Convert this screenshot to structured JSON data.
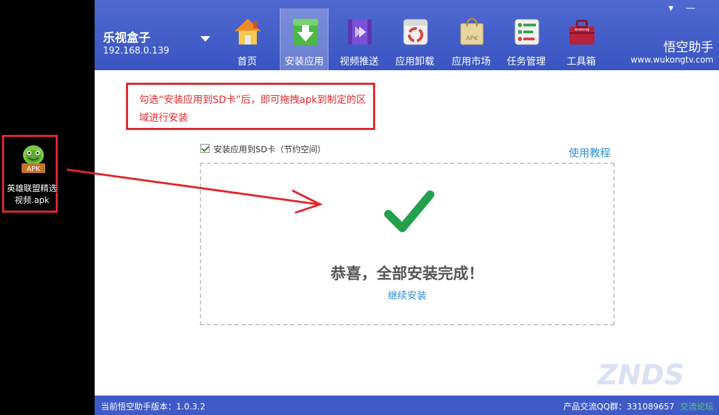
{
  "desktop": {
    "apk_file": {
      "icon": "android-apk-icon",
      "badge": "APK",
      "name": "英雄联盟精选视频.apk"
    }
  },
  "window": {
    "controls": {
      "menu": "▾",
      "minimize": "—"
    },
    "device": {
      "name": "乐视盒子",
      "ip": "192.168.0.139"
    },
    "nav": {
      "tabs": [
        {
          "label": "首页",
          "icon": "home-icon"
        },
        {
          "label": "安装应用",
          "icon": "install-download-icon",
          "active": true
        },
        {
          "label": "视频推送",
          "icon": "video-push-icon"
        },
        {
          "label": "应用卸载",
          "icon": "uninstall-icon"
        },
        {
          "label": "应用市场",
          "icon": "app-market-bag-icon",
          "icon_text": "APK"
        },
        {
          "label": "任务管理",
          "icon": "task-manager-icon"
        },
        {
          "label": "工具箱",
          "icon": "toolbox-icon",
          "icon_text": "wukong"
        }
      ]
    },
    "brand": {
      "name": "悟空助手",
      "url": "www.wukongtv.com"
    },
    "tip": {
      "text": "勾选“安装应用到SD卡”后，即可拖拽apk到制定的区域进行安装"
    },
    "sd_option": {
      "label": "安装应用到SD卡（节约空间）",
      "checked": true
    },
    "tutorial_link": "使用教程",
    "result": {
      "message": "恭喜，全部安装完成！",
      "continue_link": "继续安装"
    },
    "watermark": "ZNDS",
    "footer": {
      "version_label": "当前悟空助手版本：1.0.3.2",
      "qq_group": "产品交流QQ群：331089657",
      "forum_link": "交流论坛"
    }
  },
  "colors": {
    "header_blue": "#4a63cc",
    "annotation_red": "#e3262b",
    "link_blue": "#2f8fd4",
    "success_green": "#22a04b"
  }
}
